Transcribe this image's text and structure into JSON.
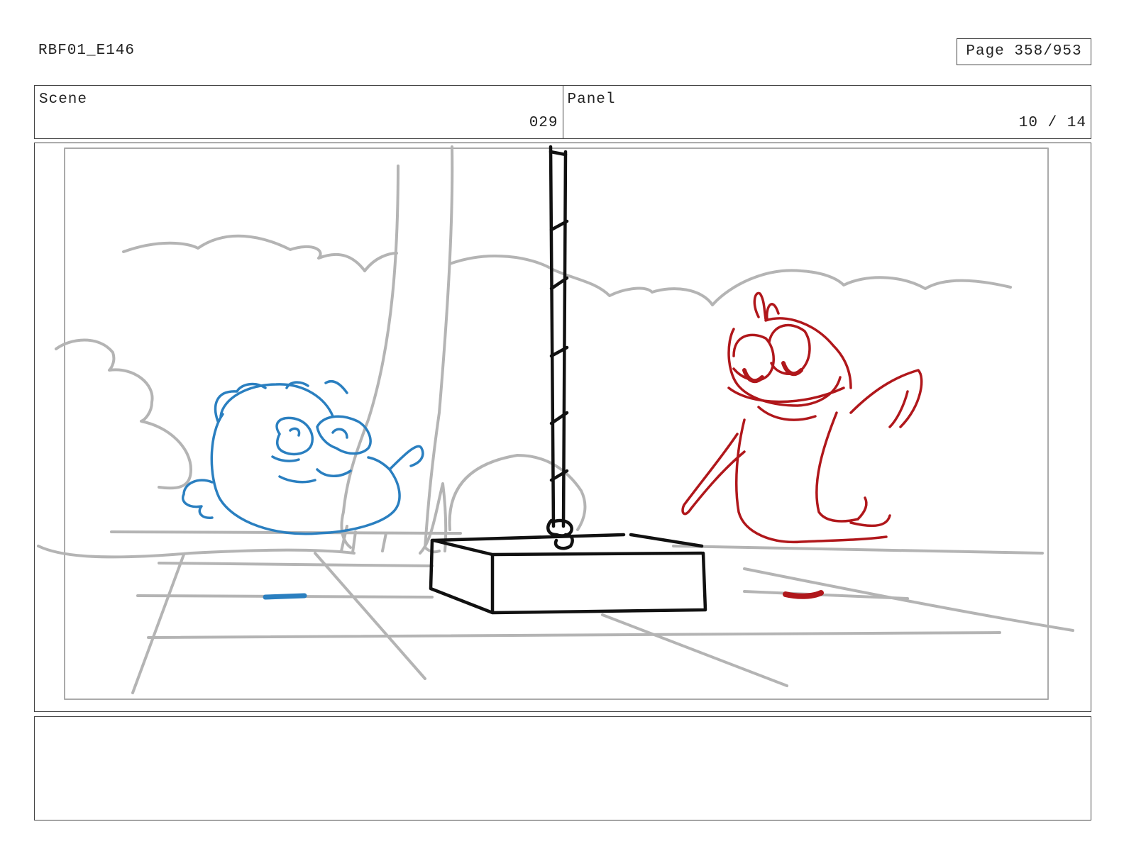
{
  "header": {
    "document_id": "RBF01_E146",
    "page_indicator": "Page 358/953"
  },
  "scene": {
    "label": "Scene",
    "value": "029"
  },
  "panel": {
    "label": "Panel",
    "value": "10 / 14"
  },
  "notes": {
    "text": ""
  },
  "colors": {
    "border": "#444444",
    "sketch_gray": "#b0b0b0",
    "character_blue": "#2a7fc0",
    "character_red": "#b0171b",
    "ink_black": "#111111"
  },
  "icons": [
    "blue-character-sketch",
    "red-character-sketch",
    "pole-base-sketch"
  ]
}
